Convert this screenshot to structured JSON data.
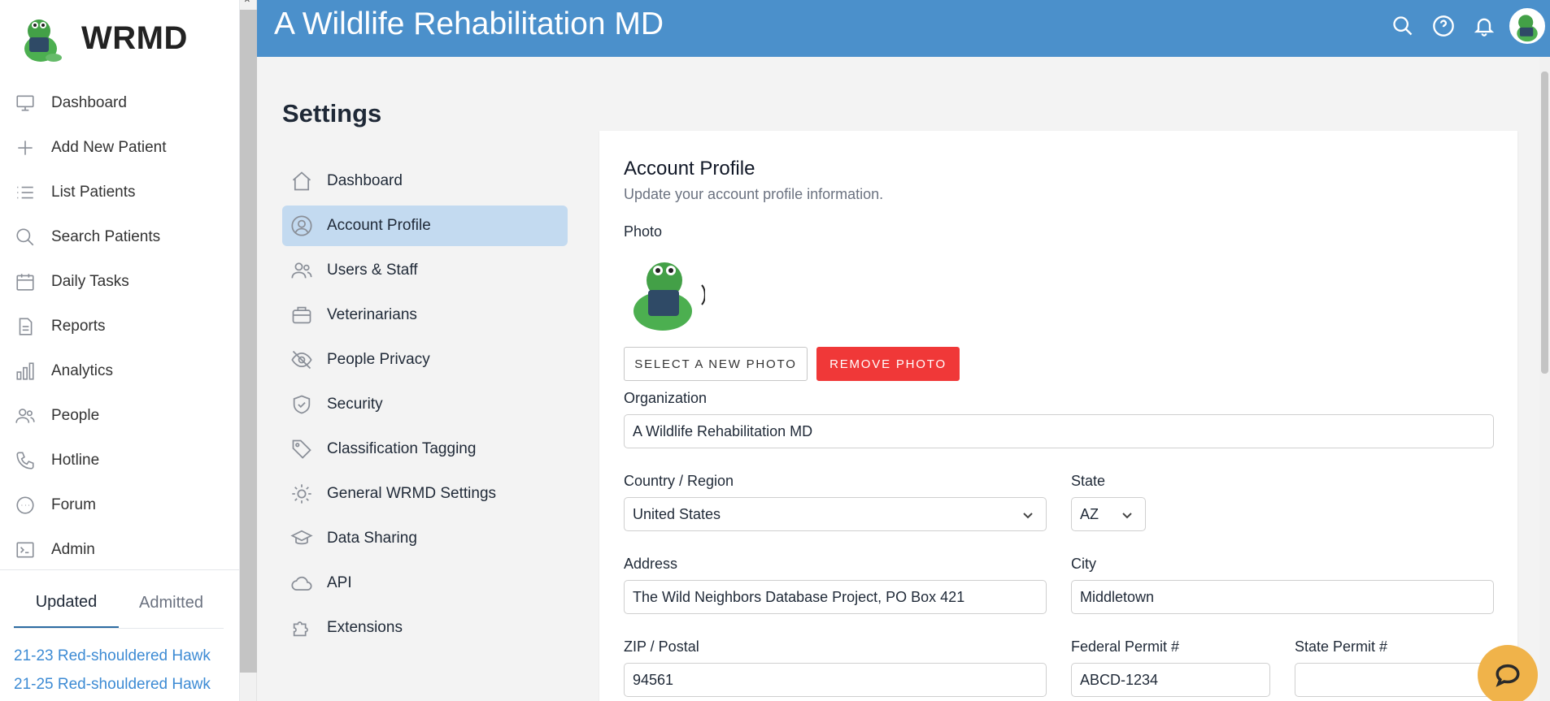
{
  "app": {
    "name": "WRMD",
    "logo_icon": "frog-mascot-logo"
  },
  "sidebar": {
    "items": [
      {
        "label": "Dashboard",
        "icon": "monitor-icon"
      },
      {
        "label": "Add New Patient",
        "icon": "plus-icon"
      },
      {
        "label": "List Patients",
        "icon": "list-icon"
      },
      {
        "label": "Search Patients",
        "icon": "search-icon"
      },
      {
        "label": "Daily Tasks",
        "icon": "calendar-icon"
      },
      {
        "label": "Reports",
        "icon": "document-icon"
      },
      {
        "label": "Analytics",
        "icon": "bar-chart-icon"
      },
      {
        "label": "People",
        "icon": "people-icon"
      },
      {
        "label": "Hotline",
        "icon": "phone-icon"
      },
      {
        "label": "Forum",
        "icon": "chat-icon"
      },
      {
        "label": "Admin",
        "icon": "terminal-icon"
      }
    ],
    "tabs": {
      "updated": "Updated",
      "admitted": "Admitted",
      "active": "updated"
    },
    "recent": [
      "21-23 Red-shouldered Hawk",
      "21-25 Red-shouldered Hawk"
    ]
  },
  "header": {
    "title": "A Wildlife Rehabilitation MD",
    "icons": [
      "search-icon",
      "help-icon",
      "bell-icon",
      "user-avatar"
    ],
    "color": "#4b90cb"
  },
  "settings": {
    "title": "Settings",
    "nav": [
      {
        "label": "Dashboard",
        "icon": "home-icon"
      },
      {
        "label": "Account Profile",
        "icon": "user-circle-icon",
        "active": true
      },
      {
        "label": "Users & Staff",
        "icon": "users-icon"
      },
      {
        "label": "Veterinarians",
        "icon": "briefcase-icon"
      },
      {
        "label": "People Privacy",
        "icon": "eye-off-icon"
      },
      {
        "label": "Security",
        "icon": "shield-icon"
      },
      {
        "label": "Classification Tagging",
        "icon": "tag-icon"
      },
      {
        "label": "General WRMD Settings",
        "icon": "cog-icon"
      },
      {
        "label": "Data Sharing",
        "icon": "academic-cap-icon"
      },
      {
        "label": "API",
        "icon": "cloud-icon"
      },
      {
        "label": "Extensions",
        "icon": "puzzle-icon"
      }
    ]
  },
  "profile": {
    "title": "Account Profile",
    "subtitle": "Update your account profile information.",
    "photo_label": "Photo",
    "select_photo": "SELECT A NEW PHOTO",
    "remove_photo": "REMOVE PHOTO",
    "organization_label": "Organization",
    "organization": "A Wildlife Rehabilitation MD",
    "country_label": "Country / Region",
    "country": "United States",
    "state_label": "State",
    "state": "AZ",
    "address_label": "Address",
    "address": "The Wild Neighbors Database Project, PO Box 421",
    "city_label": "City",
    "city": "Middletown",
    "zip_label": "ZIP / Postal",
    "zip": "94561",
    "federal_permit_label": "Federal Permit #",
    "federal_permit": "ABCD-1234",
    "state_permit_label": "State Permit #",
    "state_permit": ""
  },
  "colors": {
    "danger": "#f03838",
    "active_nav": "#c3daf0",
    "link": "#3d8bd4",
    "chat": "#f0b34a"
  }
}
